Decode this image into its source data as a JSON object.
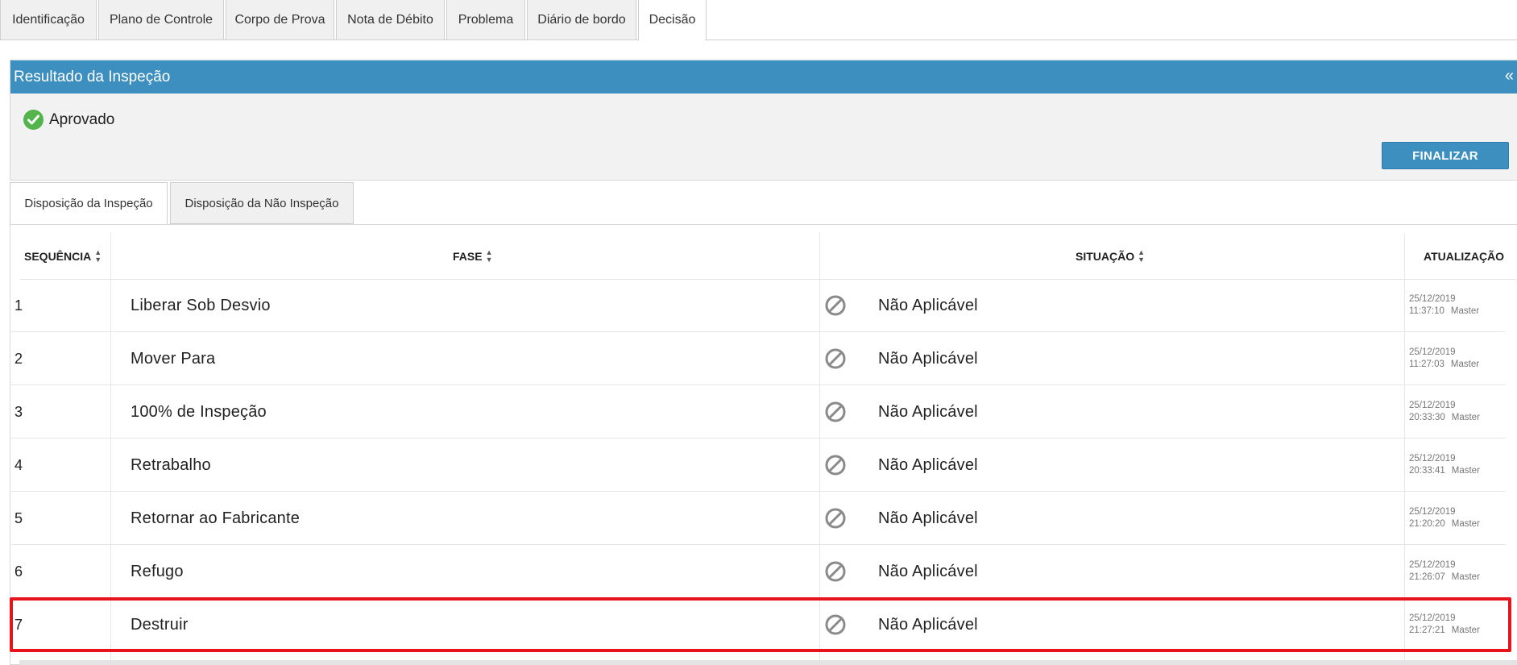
{
  "top_tabs": [
    {
      "label": "Identificação"
    },
    {
      "label": "Plano de Controle"
    },
    {
      "label": "Corpo de Prova"
    },
    {
      "label": "Nota de Débito"
    },
    {
      "label": "Problema"
    },
    {
      "label": "Diário de bordo"
    },
    {
      "label": "Decisão"
    }
  ],
  "result": {
    "title": "Resultado da Inspeção",
    "collapse": "«",
    "status": "Aprovado",
    "finalize_label": "FINALIZAR"
  },
  "sub_tabs": [
    {
      "label": "Disposição da Inspeção"
    },
    {
      "label": "Disposição da Não Inspeção"
    }
  ],
  "table": {
    "headers": {
      "sequencia": "SEQUÊNCIA",
      "fase": "FASE",
      "situacao": "SITUAÇÃO",
      "atualizacao": "ATUALIZAÇÃO"
    },
    "rows": [
      {
        "seq": "1",
        "fase": "Liberar Sob Desvio",
        "situacao": "Não Aplicável",
        "date": "25/12/2019",
        "time": "11:37:10",
        "user": "Master"
      },
      {
        "seq": "2",
        "fase": "Mover Para",
        "situacao": "Não Aplicável",
        "date": "25/12/2019",
        "time": "11:27:03",
        "user": "Master"
      },
      {
        "seq": "3",
        "fase": "100% de Inspeção",
        "situacao": "Não Aplicável",
        "date": "25/12/2019",
        "time": "20:33:30",
        "user": "Master"
      },
      {
        "seq": "4",
        "fase": "Retrabalho",
        "situacao": "Não Aplicável",
        "date": "25/12/2019",
        "time": "20:33:41",
        "user": "Master"
      },
      {
        "seq": "5",
        "fase": "Retornar ao Fabricante",
        "situacao": "Não Aplicável",
        "date": "25/12/2019",
        "time": "21:20:20",
        "user": "Master"
      },
      {
        "seq": "6",
        "fase": "Refugo",
        "situacao": "Não Aplicável",
        "date": "25/12/2019",
        "time": "21:26:07",
        "user": "Master"
      },
      {
        "seq": "7",
        "fase": "Destruir",
        "situacao": "Não Aplicável",
        "date": "25/12/2019",
        "time": "21:27:21",
        "user": "Master"
      }
    ]
  },
  "colors": {
    "accent": "#3d8fc0",
    "success": "#52b44b",
    "highlight": "#e8141c"
  },
  "icons": {
    "status": "check-circle-icon",
    "row_status": "not-applicable-icon",
    "sort": "sort-icon",
    "collapse": "double-chevron-left-icon"
  }
}
